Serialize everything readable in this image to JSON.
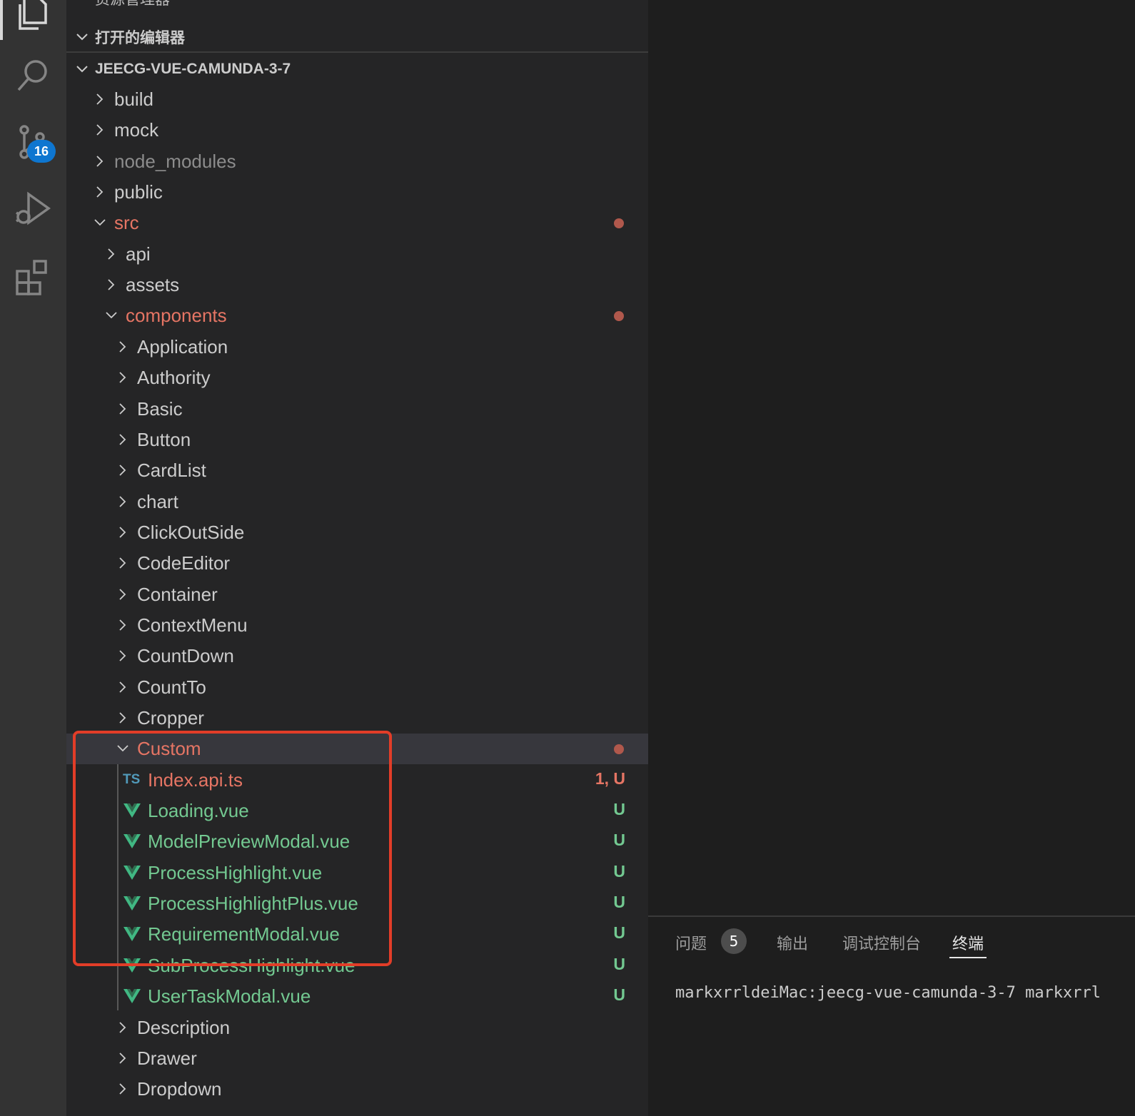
{
  "sidebar": {
    "top_title": "资源管理器",
    "open_editors_label": "打开的编辑器",
    "project_label": "JEECG-VUE-CAMUNDA-3-7"
  },
  "activity_bar": {
    "scm_badge": "16",
    "icons": [
      "explorer-icon",
      "search-icon",
      "source-control-icon",
      "run-debug-icon",
      "extensions-icon"
    ]
  },
  "tree": [
    {
      "label": "build",
      "type": "folder",
      "open": false,
      "level": 0
    },
    {
      "label": "mock",
      "type": "folder",
      "open": false,
      "level": 0
    },
    {
      "label": "node_modules",
      "type": "folder",
      "open": false,
      "level": 0,
      "dim": true
    },
    {
      "label": "public",
      "type": "folder",
      "open": false,
      "level": 0
    },
    {
      "label": "src",
      "type": "folder",
      "open": true,
      "level": 0,
      "modified": true
    },
    {
      "label": "api",
      "type": "folder",
      "open": false,
      "level": 1
    },
    {
      "label": "assets",
      "type": "folder",
      "open": false,
      "level": 1
    },
    {
      "label": "components",
      "type": "folder",
      "open": true,
      "level": 1,
      "modified": true
    },
    {
      "label": "Application",
      "type": "folder",
      "open": false,
      "level": 2
    },
    {
      "label": "Authority",
      "type": "folder",
      "open": false,
      "level": 2
    },
    {
      "label": "Basic",
      "type": "folder",
      "open": false,
      "level": 2
    },
    {
      "label": "Button",
      "type": "folder",
      "open": false,
      "level": 2
    },
    {
      "label": "CardList",
      "type": "folder",
      "open": false,
      "level": 2
    },
    {
      "label": "chart",
      "type": "folder",
      "open": false,
      "level": 2
    },
    {
      "label": "ClickOutSide",
      "type": "folder",
      "open": false,
      "level": 2
    },
    {
      "label": "CodeEditor",
      "type": "folder",
      "open": false,
      "level": 2
    },
    {
      "label": "Container",
      "type": "folder",
      "open": false,
      "level": 2
    },
    {
      "label": "ContextMenu",
      "type": "folder",
      "open": false,
      "level": 2
    },
    {
      "label": "CountDown",
      "type": "folder",
      "open": false,
      "level": 2
    },
    {
      "label": "CountTo",
      "type": "folder",
      "open": false,
      "level": 2
    },
    {
      "label": "Cropper",
      "type": "folder",
      "open": false,
      "level": 2
    },
    {
      "label": "Custom",
      "type": "folder",
      "open": true,
      "level": 2,
      "modified": true,
      "selected": true
    },
    {
      "label": "Index.api.ts",
      "type": "ts",
      "level": 3,
      "status": "1, U",
      "color": "mod",
      "icon_text": "TS"
    },
    {
      "label": "Loading.vue",
      "type": "vue",
      "level": 3,
      "status": "U",
      "color": "new"
    },
    {
      "label": "ModelPreviewModal.vue",
      "type": "vue",
      "level": 3,
      "status": "U",
      "color": "new"
    },
    {
      "label": "ProcessHighlight.vue",
      "type": "vue",
      "level": 3,
      "status": "U",
      "color": "new"
    },
    {
      "label": "ProcessHighlightPlus.vue",
      "type": "vue",
      "level": 3,
      "status": "U",
      "color": "new"
    },
    {
      "label": "RequirementModal.vue",
      "type": "vue",
      "level": 3,
      "status": "U",
      "color": "new"
    },
    {
      "label": "SubProcessHighlight.vue",
      "type": "vue",
      "level": 3,
      "status": "U",
      "color": "new"
    },
    {
      "label": "UserTaskModal.vue",
      "type": "vue",
      "level": 3,
      "status": "U",
      "color": "new"
    },
    {
      "label": "Description",
      "type": "folder",
      "open": false,
      "level": 2
    },
    {
      "label": "Drawer",
      "type": "folder",
      "open": false,
      "level": 2
    },
    {
      "label": "Dropdown",
      "type": "folder",
      "open": false,
      "level": 2
    }
  ],
  "panel": {
    "tabs": [
      "问题",
      "输出",
      "调试控制台",
      "终端"
    ],
    "problems_count": "5",
    "active_tab": "终端",
    "terminal_line": "markxrrldeiMac:jeecg-vue-camunda-3-7 markxrrl"
  },
  "colors": {
    "modified": "#e67564",
    "untracked": "#73c991",
    "ts_icon": "#519aba",
    "vue_icon": "#41b883",
    "highlight_box": "#e23d28"
  }
}
